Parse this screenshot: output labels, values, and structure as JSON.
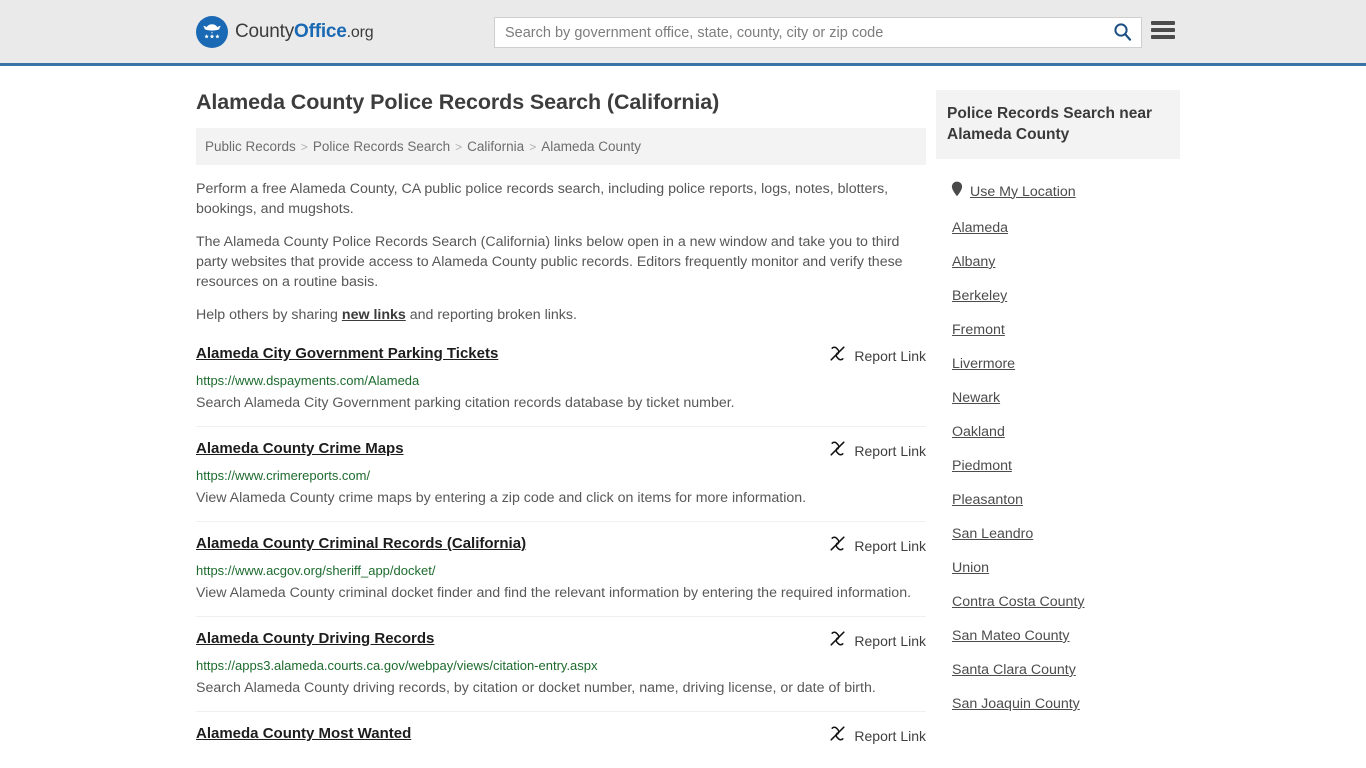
{
  "header": {
    "logo": {
      "icon": "eagle-seal-icon",
      "text_part1": "County",
      "text_part2": "Office",
      "text_part3": ".org"
    },
    "search": {
      "placeholder": "Search by government office, state, county, city or zip code",
      "value": "",
      "search_icon": "search-icon"
    },
    "menu_icon": "hamburger-menu-icon",
    "accent_color": "#3b72a8",
    "background_color": "#ebeaea"
  },
  "main": {
    "title": "Alameda County Police Records Search (California)",
    "breadcrumb": [
      "Public Records",
      "Police Records Search",
      "California",
      "Alameda County"
    ],
    "breadcrumb_separator": ">",
    "paragraphs": {
      "p1": "Perform a free Alameda County, CA public police records search, including police reports, logs, notes, blotters, bookings, and mugshots.",
      "p2": "The Alameda County Police Records Search (California) links below open in a new window and take you to third party websites that provide access to Alameda County public records. Editors frequently monitor and verify these resources on a routine basis.",
      "p3_before": "Help others by sharing ",
      "p3_link": "new links",
      "p3_after": " and reporting broken links."
    },
    "report_link_label": "Report Link",
    "report_link_icon": "broken-link-icon",
    "results": [
      {
        "title": "Alameda City Government Parking Tickets",
        "url": "https://www.dspayments.com/Alameda",
        "description": "Search Alameda City Government parking citation records database by ticket number."
      },
      {
        "title": "Alameda County Crime Maps",
        "url": "https://www.crimereports.com/",
        "description": "View Alameda County crime maps by entering a zip code and click on items for more information."
      },
      {
        "title": "Alameda County Criminal Records (California)",
        "url": "https://www.acgov.org/sheriff_app/docket/",
        "description": "View Alameda County criminal docket finder and find the relevant information by entering the required information."
      },
      {
        "title": "Alameda County Driving Records",
        "url": "https://apps3.alameda.courts.ca.gov/webpay/views/citation-entry.aspx",
        "description": "Search Alameda County driving records, by citation or docket number, name, driving license, or date of birth."
      },
      {
        "title": "Alameda County Most Wanted",
        "url": "",
        "description": ""
      }
    ]
  },
  "sidebar": {
    "heading": "Police Records Search near Alameda County",
    "use_my_location": {
      "label": "Use My Location",
      "icon": "location-pin-icon"
    },
    "items": [
      {
        "label": "Alameda"
      },
      {
        "label": "Albany"
      },
      {
        "label": "Berkeley"
      },
      {
        "label": "Fremont"
      },
      {
        "label": "Livermore"
      },
      {
        "label": "Newark"
      },
      {
        "label": "Oakland"
      },
      {
        "label": "Piedmont"
      },
      {
        "label": "Pleasanton"
      },
      {
        "label": "San Leandro"
      },
      {
        "label": "Union"
      },
      {
        "label": "Contra Costa County"
      },
      {
        "label": "San Mateo County"
      },
      {
        "label": "Santa Clara County"
      },
      {
        "label": "San Joaquin County"
      }
    ]
  },
  "colors": {
    "link_green": "#1d6b2e",
    "brand_blue": "#1a69b4",
    "panel_gray": "#f3f3f3"
  }
}
